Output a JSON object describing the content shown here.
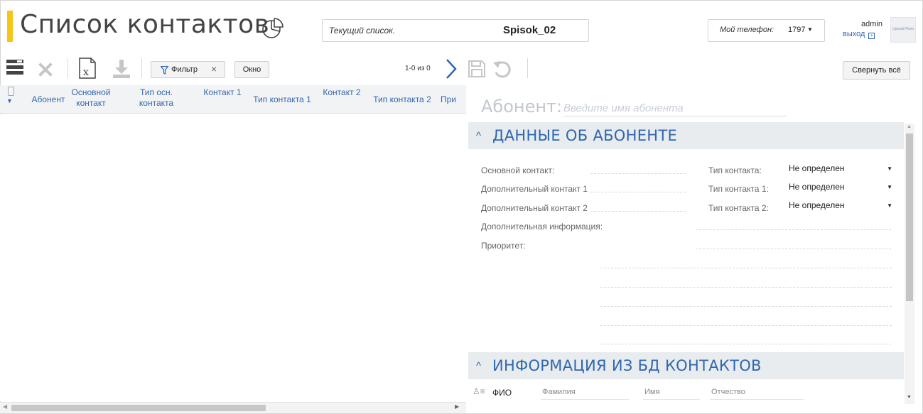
{
  "header": {
    "title": "Список контактов",
    "current_list": {
      "label": "Текущий список.",
      "value": "Spisok_02"
    },
    "phone": {
      "label": "Мой телефон:",
      "value": "1797"
    },
    "user": {
      "name": "admin",
      "logout": "выход"
    },
    "avatar_alt": "Upload Photo"
  },
  "toolbar": {
    "filter_label": "Фильтр",
    "window_label": "Окно",
    "pager_text": "1-0 из 0",
    "collapse_label": "Свернуть всё"
  },
  "grid": {
    "columns": [
      "Абонент",
      "Основной контакт",
      "Тип осн. контакта",
      "Контакт 1",
      "Тип контакта 1",
      "Контакт 2",
      "Тип контакта 2",
      "При"
    ]
  },
  "form": {
    "subscriber_label": "Абонент:",
    "subscriber_placeholder": "Введите имя абонента",
    "section1_title": "ДАННЫЕ ОБ АБОНЕНТЕ",
    "fields": {
      "main_contact": "Основной контакт:",
      "extra_contact_1": "Дополнительный контакт 1",
      "extra_contact_2": "Дополнительный контакт 2",
      "extra_info": "Дополнительная информация:",
      "priority": "Приоритет:",
      "contact_type": "Тип контакта:",
      "contact_type_1": "Тип контакта 1:",
      "contact_type_2": "Тип контакта 2:"
    },
    "selects": {
      "contact_type": "Не определен",
      "contact_type_1": "Не определен",
      "contact_type_2": "Не определен"
    },
    "section2_title": "ИНФОРМАЦИЯ ИЗ БД КОНТАКТОВ",
    "fio": {
      "label": "ФИО",
      "surname_placeholder": "Фамилия",
      "name_placeholder": "Имя",
      "patronymic_placeholder": "Отчество"
    }
  },
  "colors": {
    "accent": "#f5c518",
    "link_blue": "#2f67b0",
    "section_bg": "#e9ecef"
  }
}
